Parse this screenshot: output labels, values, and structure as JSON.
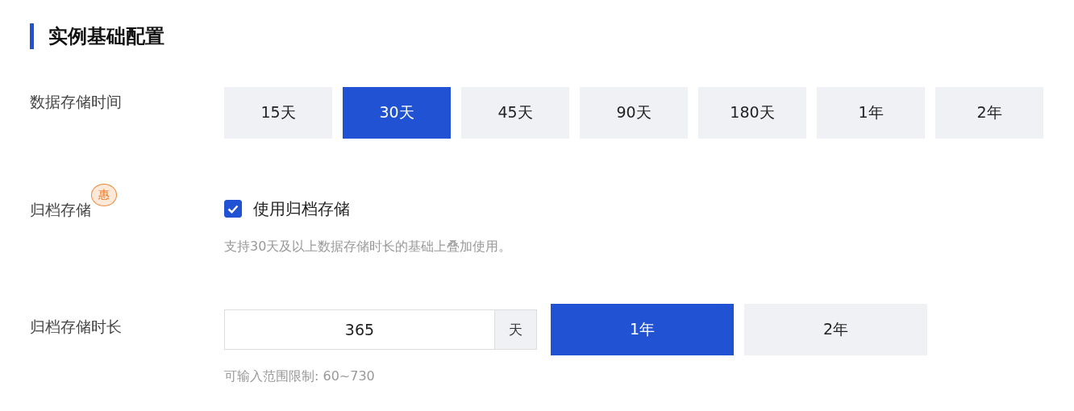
{
  "section_title": "实例基础配置",
  "storage_time": {
    "label": "数据存储时间",
    "options": [
      {
        "label": "15天",
        "selected": false
      },
      {
        "label": "30天",
        "selected": true
      },
      {
        "label": "45天",
        "selected": false
      },
      {
        "label": "90天",
        "selected": false
      },
      {
        "label": "180天",
        "selected": false
      },
      {
        "label": "1年",
        "selected": false
      },
      {
        "label": "2年",
        "selected": false
      }
    ]
  },
  "archive": {
    "label": "归档存储",
    "badge": "惠",
    "checkbox": {
      "label": "使用归档存储",
      "checked": true
    },
    "hint": "支持30天及以上数据存储时长的基础上叠加使用。"
  },
  "archive_duration": {
    "label": "归档存储时长",
    "input": {
      "value": "365",
      "unit": "天"
    },
    "options": [
      {
        "label": "1年",
        "selected": true
      },
      {
        "label": "2年",
        "selected": false
      }
    ],
    "hint": "可输入范围限制: 60~730"
  }
}
